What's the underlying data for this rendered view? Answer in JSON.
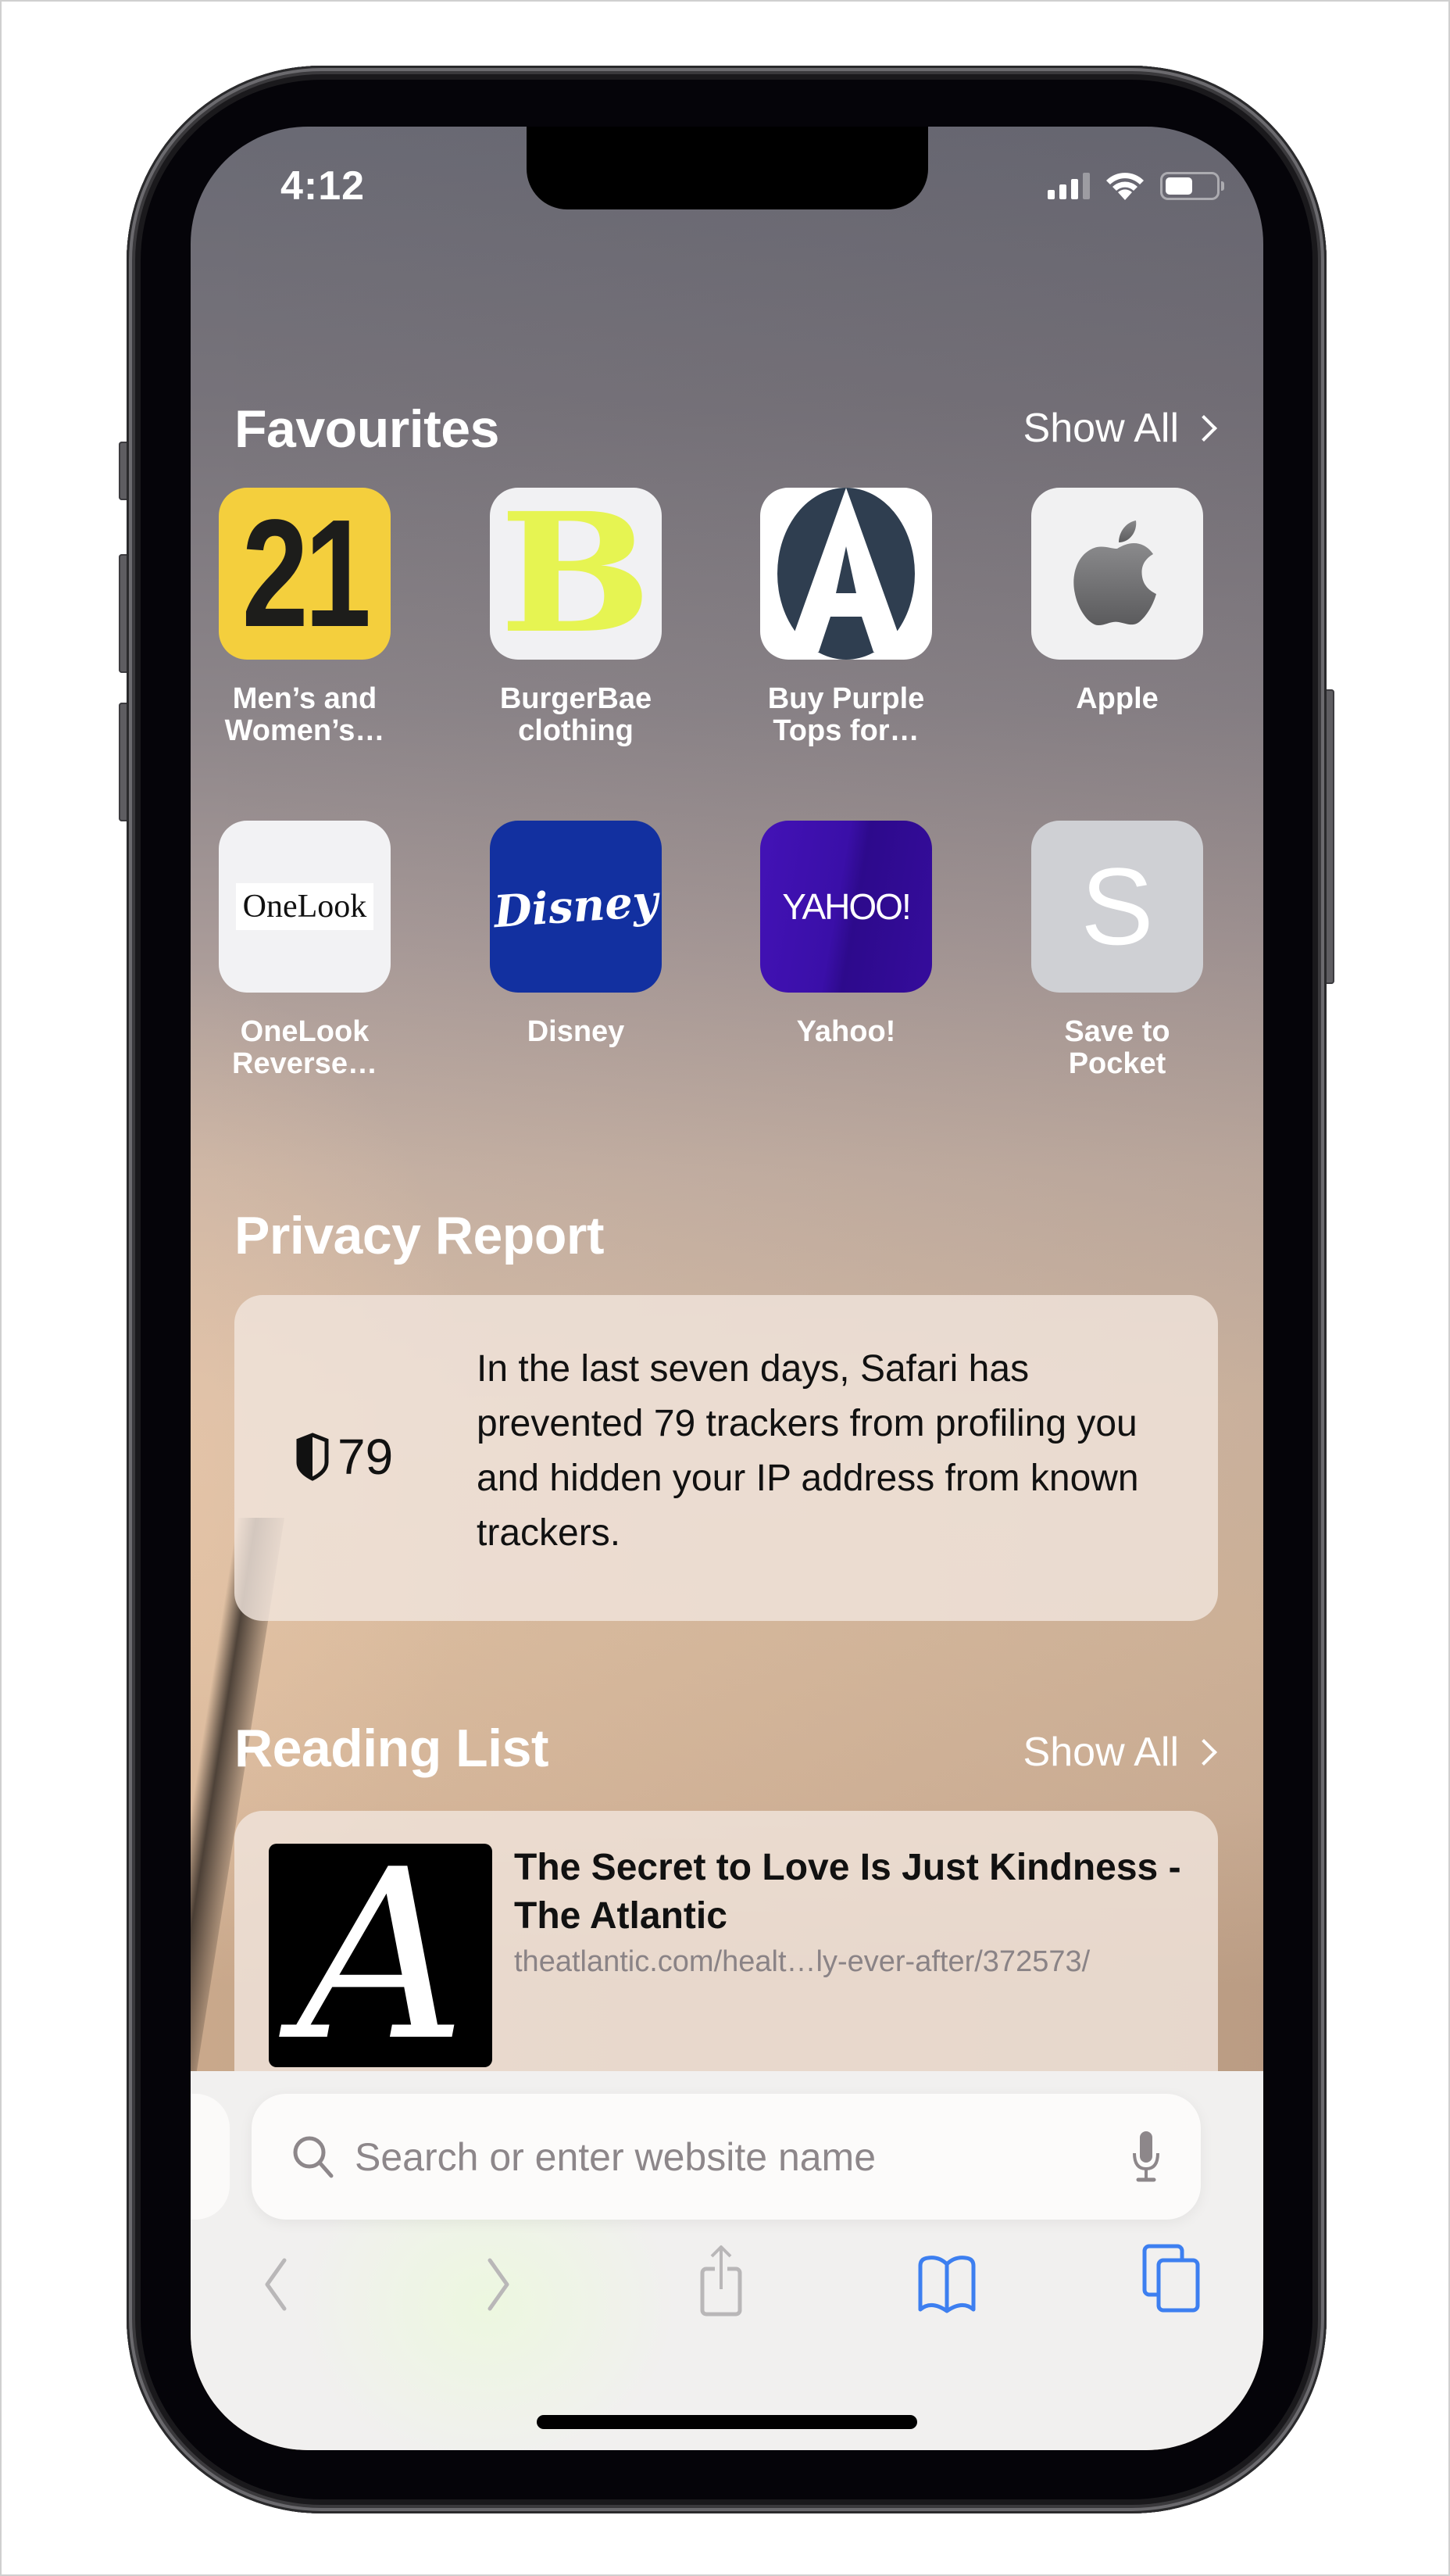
{
  "status_bar": {
    "time": "4:12",
    "signal_bars_active": 3,
    "signal_bars_total": 4,
    "wifi": "full",
    "battery_level_percent": 55
  },
  "favourites": {
    "title": "Favourites",
    "show_all_label": "Show All",
    "items": [
      {
        "label_line1": "Men’s and",
        "label_line2": "Women’s…",
        "icon": "forever21-icon",
        "glyph": "21",
        "bg": "#f4cf3d",
        "fg": "#1d1d1b"
      },
      {
        "label_line1": "BurgerBae",
        "label_line2": "clothing",
        "icon": "burgerbae-icon",
        "glyph": "B",
        "bg": "#f1f1f3",
        "fg": "#e6f452"
      },
      {
        "label_line1": "Buy Purple",
        "label_line2": "Tops for…",
        "icon": "purple-tops-icon",
        "glyph": "A",
        "bg": "#ffffff",
        "fg": "#2f3e50"
      },
      {
        "label_line1": "Apple",
        "label_line2": "",
        "icon": "apple-logo-icon",
        "glyph": "",
        "bg": "#f1f1f2",
        "fg": "#6e6e70"
      },
      {
        "label_line1": "OneLook",
        "label_line2": "Reverse…",
        "icon": "onelook-icon",
        "glyph": "OneLook",
        "bg": "#f2f2f4",
        "fg": "#111111"
      },
      {
        "label_line1": "Disney",
        "label_line2": "",
        "icon": "disney-icon",
        "glyph": "Disney",
        "bg": "#1230a0",
        "fg": "#ffffff"
      },
      {
        "label_line1": "Yahoo!",
        "label_line2": "",
        "icon": "yahoo-icon",
        "glyph": "YAHOO!",
        "bg": "#3b0fa8",
        "fg": "#ffffff"
      },
      {
        "label_line1": "Save to",
        "label_line2": "Pocket",
        "icon": "letter-s-icon",
        "glyph": "S",
        "bg": "#cfd0d4",
        "fg": "#ffffff"
      }
    ]
  },
  "privacy_report": {
    "title": "Privacy Report",
    "tracker_count": "79",
    "text": "In the last seven days, Safari has prevented 79 trackers from profiling you and hidden your IP address from known trackers."
  },
  "reading_list": {
    "title": "Reading List",
    "show_all_label": "Show All",
    "items": [
      {
        "title": "The Secret to Love Is Just Kindness - The Atlantic",
        "url": "theatlantic.com/healt…ly-ever-after/372573/",
        "thumb_glyph": "A"
      }
    ]
  },
  "toolbar": {
    "search_placeholder": "Search or enter website name",
    "accent_color": "#3d7ff0",
    "disabled_color": "#b9b7b8"
  }
}
